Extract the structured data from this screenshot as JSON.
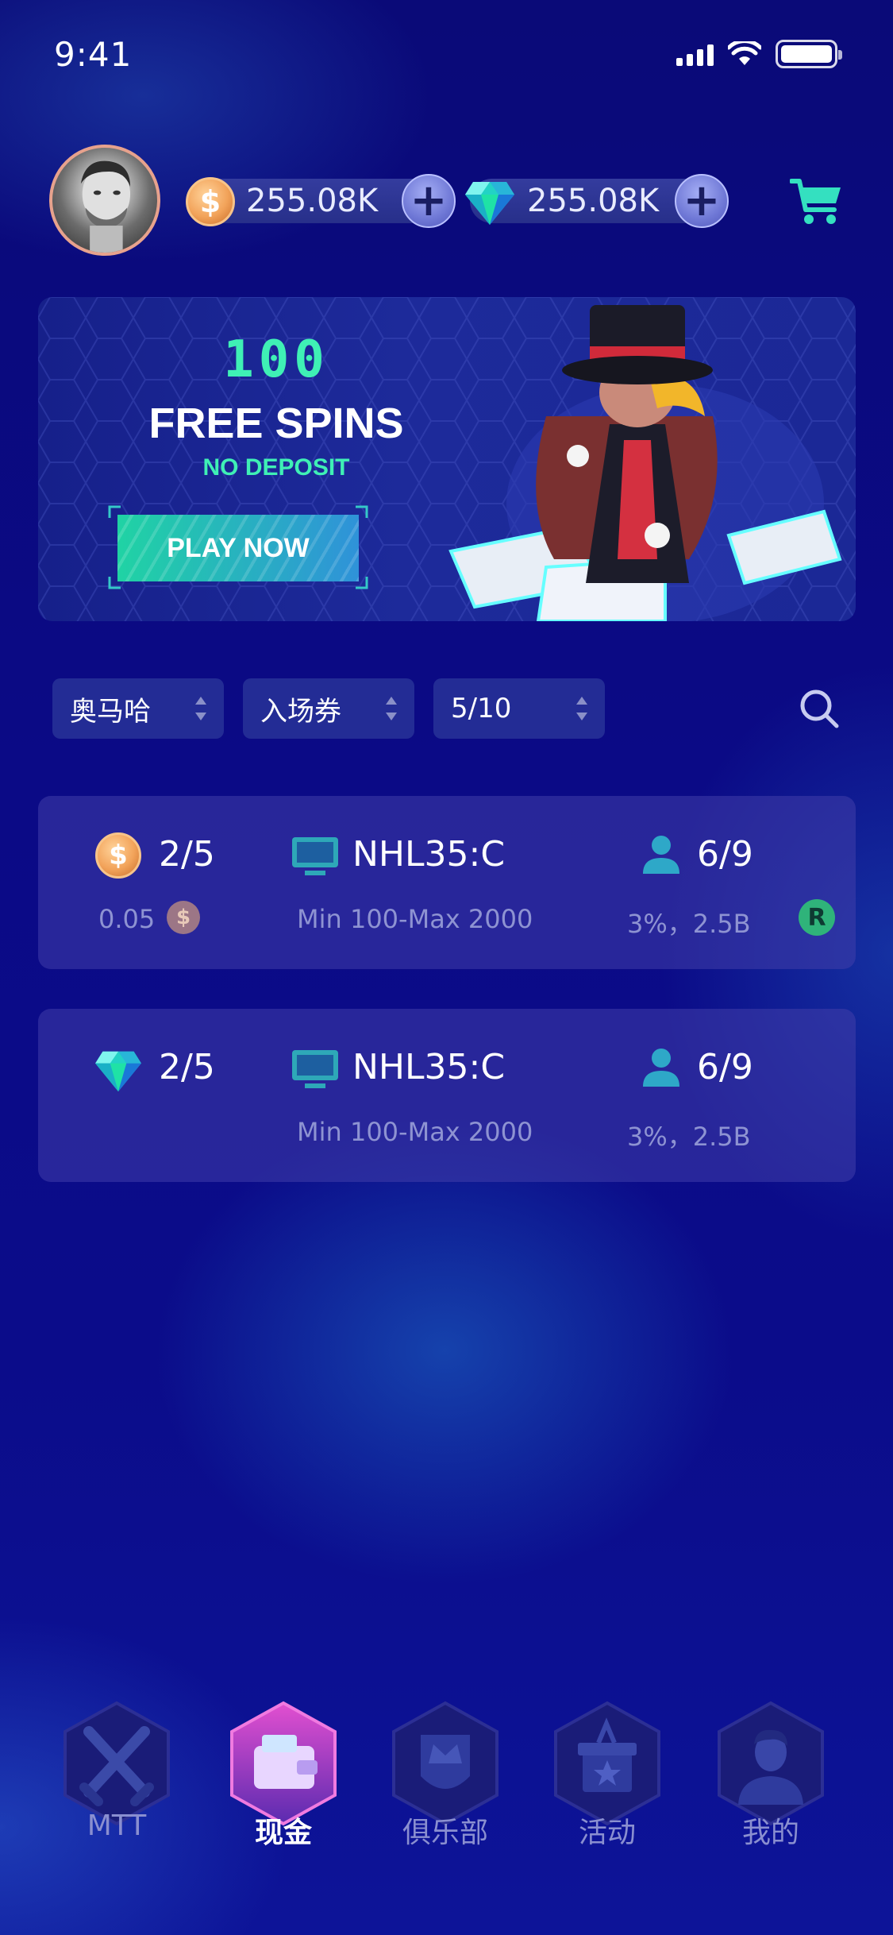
{
  "status_bar": {
    "time": "9:41"
  },
  "header": {
    "coins": "255.08K",
    "diamonds": "255.08K"
  },
  "banner": {
    "amount": "100",
    "title": "FREE SPINS",
    "subtitle": "NO DEPOSIT",
    "cta": "PLAY NOW"
  },
  "filters": [
    {
      "label": "奥马哈"
    },
    {
      "label": "入场券"
    },
    {
      "label": "5/10"
    }
  ],
  "tables": [
    {
      "currency_icon": "coin-icon",
      "blinds": "2/5",
      "min_bet": "0.05",
      "name": "NHL35:C",
      "limits": "Min 100-Max 2000",
      "players": "6/9",
      "rake": "3%，2.5B",
      "badge": "R"
    },
    {
      "currency_icon": "diamond-icon",
      "blinds": "2/5",
      "name": "NHL35:C",
      "limits": "Min 100-Max 2000",
      "players": "6/9",
      "rake": "3%，2.5B"
    }
  ],
  "nav": [
    {
      "label": "MTT",
      "icon": "crossed-swords-icon",
      "active": false
    },
    {
      "label": "现金",
      "icon": "wallet-icon",
      "active": true
    },
    {
      "label": "俱乐部",
      "icon": "crown-shield-icon",
      "active": false
    },
    {
      "label": "活动",
      "icon": "gift-box-icon",
      "active": false
    },
    {
      "label": "我的",
      "icon": "profile-icon",
      "active": false
    }
  ],
  "colors": {
    "accent": "#3ff0b5",
    "background": "#0a0a78",
    "card": "#2f2b9a",
    "active_nav": "#c84bd8"
  }
}
